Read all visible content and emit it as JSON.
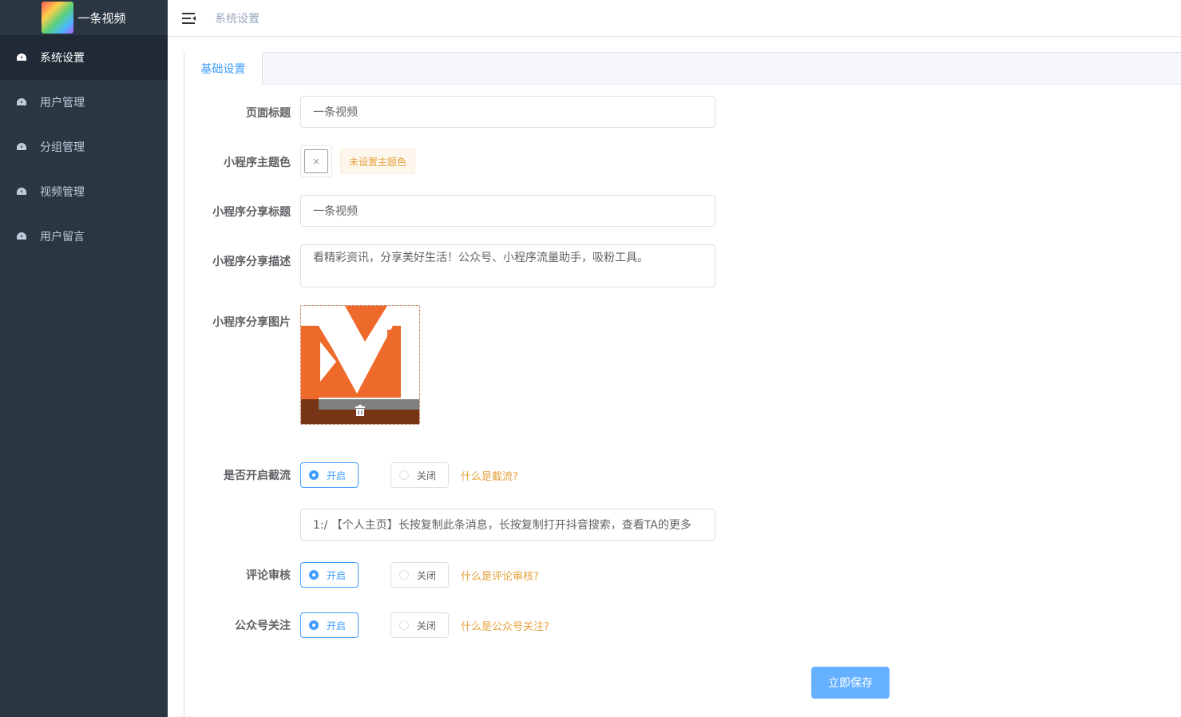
{
  "app": {
    "name": "一条视频"
  },
  "sidebar": {
    "items": [
      {
        "label": "系统设置",
        "active": true
      },
      {
        "label": "用户管理"
      },
      {
        "label": "分组管理"
      },
      {
        "label": "视频管理"
      },
      {
        "label": "用户留言"
      }
    ]
  },
  "header": {
    "breadcrumb": "系统设置"
  },
  "tabs": [
    {
      "label": "基础设置",
      "active": true
    }
  ],
  "form": {
    "page_title": {
      "label": "页面标题",
      "value": "一条视频"
    },
    "theme_color": {
      "label": "小程序主题色",
      "value_icon": "×",
      "status": "未设置主题色"
    },
    "share_title": {
      "label": "小程序分享标题",
      "value": "一条视频"
    },
    "share_desc": {
      "label": "小程序分享描述",
      "value": "看精彩资讯，分享美好生活！公众号、小程序流量助手，吸粉工具。"
    },
    "share_image": {
      "label": "小程序分享图片",
      "brand_color": "#ee6a2b",
      "overlay_icon": "trash-icon"
    },
    "intercept": {
      "label": "是否开启截流",
      "on": "开启",
      "off": "关闭",
      "selected": "on",
      "help": "什么是截流?",
      "text": "1:/ 【个人主页】长按复制此条消息，长按复制打开抖音搜索，查看TA的更多"
    },
    "comment_review": {
      "label": "评论审核",
      "on": "开启",
      "off": "关闭",
      "selected": "on",
      "help": "什么是评论审核?"
    },
    "follow_oa": {
      "label": "公众号关注",
      "on": "开启",
      "off": "关闭",
      "selected": "on",
      "help": "什么是公众号关注?"
    }
  },
  "actions": {
    "save": "立即保存"
  },
  "colors": {
    "sidebar_bg": "#2b3643",
    "primary": "#409eff",
    "warning": "#e6a23c",
    "save_button": "#66b1ff"
  }
}
